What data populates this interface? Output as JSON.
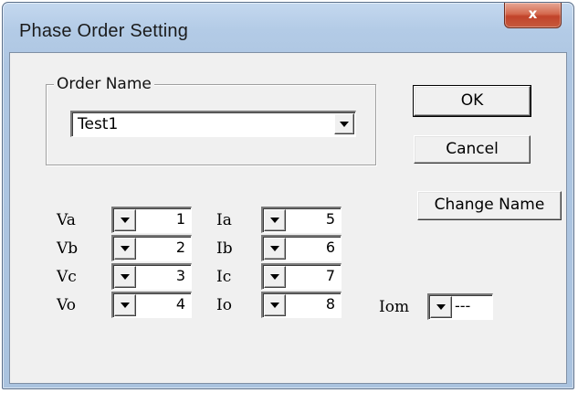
{
  "window": {
    "title": "Phase Order Setting",
    "close_label": "x"
  },
  "order_name": {
    "group_label": "Order Name",
    "selected": "Test1"
  },
  "buttons": {
    "ok": "OK",
    "cancel": "Cancel",
    "change_name": "Change Name"
  },
  "phases": {
    "va": {
      "label": "Va",
      "value": "1"
    },
    "vb": {
      "label": "Vb",
      "value": "2"
    },
    "vc": {
      "label": "Vc",
      "value": "3"
    },
    "vo": {
      "label": "Vo",
      "value": "4"
    },
    "ia": {
      "label": "Ia",
      "value": "5"
    },
    "ib": {
      "label": "Ib",
      "value": "6"
    },
    "ic": {
      "label": "Ic",
      "value": "7"
    },
    "io": {
      "label": "Io",
      "value": "8"
    },
    "iom": {
      "label": "Iom",
      "value": "---"
    }
  },
  "icons": {
    "dropdown": "triangle-down-icon",
    "close": "close-icon"
  },
  "colors": {
    "title_bar": "#b3cbe6",
    "close_button": "#c65a3d",
    "dialog_body": "#f0f0f0"
  }
}
